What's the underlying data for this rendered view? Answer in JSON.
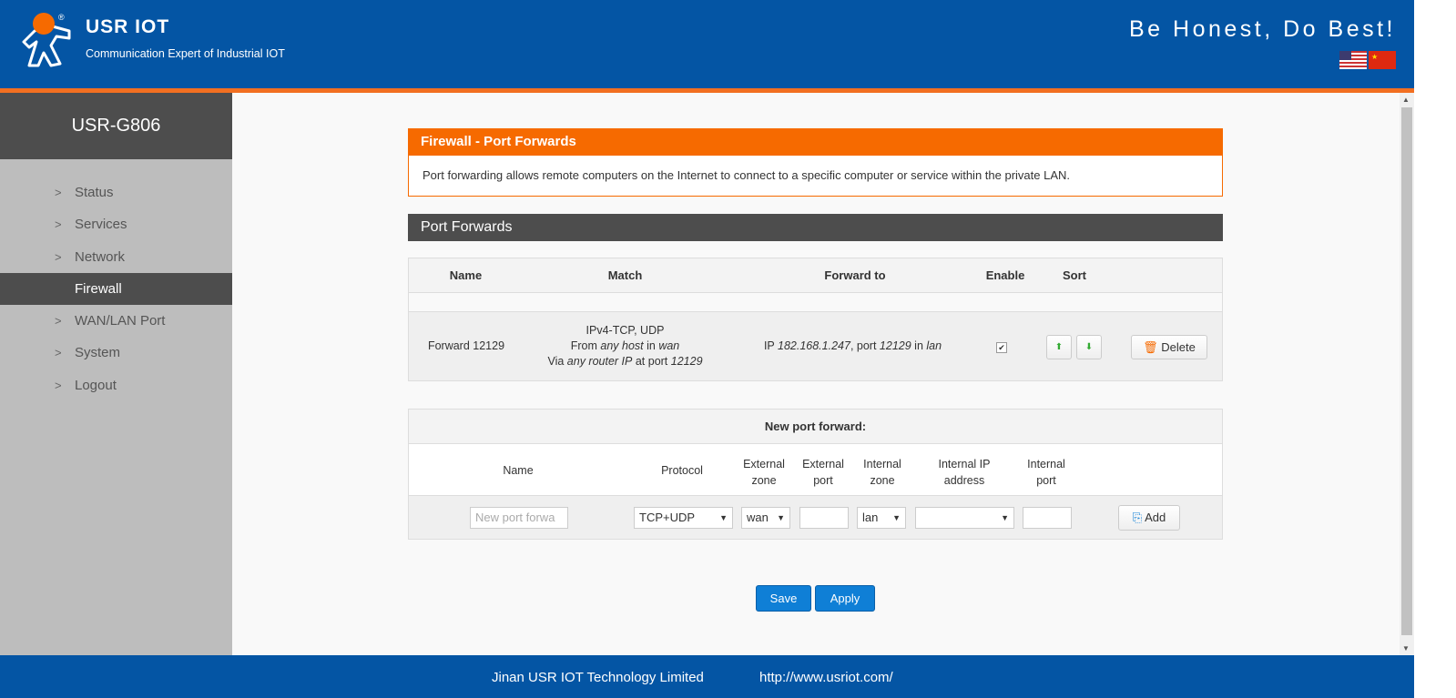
{
  "header": {
    "brand": "USR IOT",
    "tagline": "Communication Expert of Industrial IOT",
    "slogan": "Be Honest, Do Best!",
    "languages": [
      "en-US",
      "zh-CN"
    ]
  },
  "sidebar": {
    "title": "USR-G806",
    "items": [
      {
        "label": "Status"
      },
      {
        "label": "Services"
      },
      {
        "label": "Network"
      },
      {
        "label": "Firewall",
        "active": true
      },
      {
        "label": "WAN/LAN Port"
      },
      {
        "label": "System"
      },
      {
        "label": "Logout"
      }
    ]
  },
  "alert": {
    "title": "Firewall - Port Forwards",
    "body": "Port forwarding allows remote computers on the Internet to connect to a specific computer or service within the private LAN."
  },
  "section": {
    "title": "Port Forwards"
  },
  "table": {
    "headers": [
      "Name",
      "Match",
      "Forward to",
      "Enable",
      "Sort"
    ],
    "rows": [
      {
        "name": "Forward 12129",
        "match_line1": "IPv4-TCP, UDP",
        "from_pre": "From ",
        "from_host": "any host",
        "from_mid": " in ",
        "from_zone": "wan",
        "via_pre": "Via ",
        "via_ip": "any router IP",
        "via_mid": " at port ",
        "via_port": "12129",
        "fwd_pre": "IP ",
        "fwd_ip": "182.168.1.247",
        "fwd_mid": ", port ",
        "fwd_port": "12129",
        "fwd_in": " in ",
        "fwd_zone": "lan",
        "enabled": true,
        "delete_label": "Delete"
      }
    ]
  },
  "new_forward": {
    "title": "New port forward:",
    "headers": {
      "name": "Name",
      "protocol": "Protocol",
      "ext_zone_1": "External",
      "ext_zone_2": "zone",
      "ext_port_1": "External",
      "ext_port_2": "port",
      "int_zone_1": "Internal",
      "int_zone_2": "zone",
      "int_ip_1": "Internal IP",
      "int_ip_2": "address",
      "int_port_1": "Internal",
      "int_port_2": "port"
    },
    "name_placeholder": "New port forwa",
    "protocol": "TCP+UDP",
    "ext_zone": "wan",
    "ext_port": "",
    "int_zone": "lan",
    "int_ip": "",
    "int_port": "",
    "add_label": "Add"
  },
  "actions": {
    "save": "Save",
    "apply": "Apply"
  },
  "footer": {
    "company": "Jinan USR IOT Technology Limited",
    "url": "http://www.usriot.com/"
  },
  "colors": {
    "header": "#0455a4",
    "accent": "#f66a00",
    "dark": "#4d4d4d",
    "button": "#0f7fd6"
  }
}
